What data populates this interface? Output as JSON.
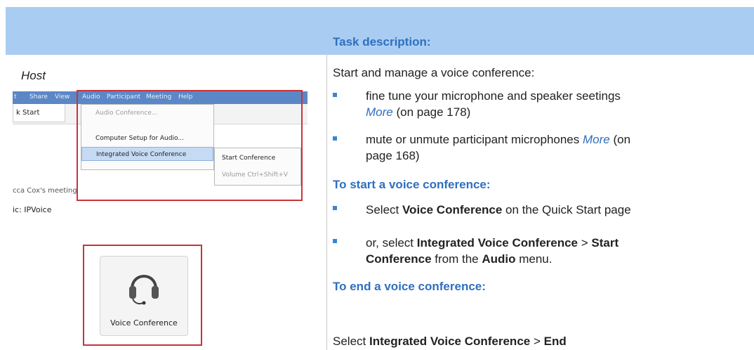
{
  "header": {
    "task_title": "Task description:"
  },
  "left": {
    "host_label": "Host",
    "menu_shot": {
      "menubar": [
        "t",
        "Share",
        "View",
        "Audio",
        "Participant",
        "Meeting",
        "Help"
      ],
      "tab_label": "k Start",
      "dropdown_items": [
        "Audio Conference...",
        "Computer Setup for Audio...",
        "Integrated Voice Conference"
      ],
      "submenu_items": [
        "Start Conference",
        "Volume    Ctrl+Shift+V"
      ],
      "meeting_text": "cca Cox's meeting",
      "audio_text": "ic:  IPVoice"
    },
    "voice_button_label": "Voice Conference"
  },
  "right": {
    "intro": "Start and manage a voice conference:",
    "bullets1": [
      {
        "text_line1": "fine tune your microphone and speaker seetings",
        "more": "More",
        "page": " (on page 178)"
      },
      {
        "text": "mute or unmute participant microphones ",
        "more": "More",
        "tail": " (on",
        "line2": "page 168)"
      }
    ],
    "start_header": "To start a voice conference:",
    "start_bullets": {
      "b1_pre": "Select ",
      "b1_bold": "Voice Conference",
      "b1_post": " on the Quick Start page",
      "b2_pre": "or, select ",
      "b2_bold1": "Integrated Voice Conference",
      "b2_mid": " > ",
      "b2_bold2": "Start",
      "b2_line2_bold": "Conference",
      "b2_line2_mid": " from the ",
      "b2_line2_bold2": "Audio",
      "b2_line2_post": " menu."
    },
    "end_header": "To end a voice conference:",
    "end_line": {
      "pre": "Select ",
      "bold1": "Integrated Voice Conference",
      "mid": " > ",
      "bold2": "End"
    }
  },
  "colors": {
    "band": "#a9cdf2",
    "heading": "#2f6fbf",
    "bullet": "#3a84d8",
    "highlight_box": "#c9333b"
  }
}
